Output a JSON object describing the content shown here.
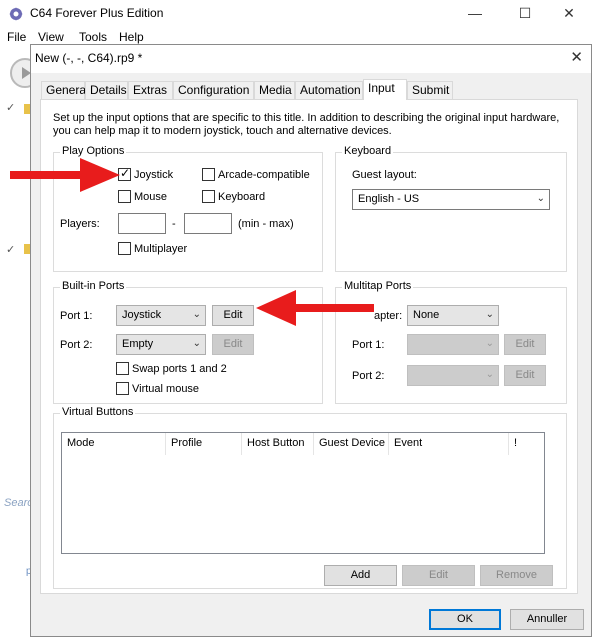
{
  "main_window": {
    "title": "C64 Forever Plus Edition",
    "menu": [
      "File",
      "View",
      "Tools",
      "Help"
    ],
    "search_placeholder": "Searc"
  },
  "dialog": {
    "title": "New (-, -, C64).rp9 *",
    "tabs": [
      "General",
      "Details",
      "Extras",
      "Configuration",
      "Media",
      "Automation",
      "Input",
      "Submit"
    ],
    "active_tab": "Input",
    "description": "Set up the input options that are specific to this title. In addition to describing the original input hardware, you can help map it to modern joystick, touch and alternative devices.",
    "play_options": {
      "legend": "Play Options",
      "joystick": "Joystick",
      "joystick_checked": true,
      "arcade": "Arcade-compatible",
      "arcade_checked": false,
      "mouse": "Mouse",
      "mouse_checked": false,
      "keyboard": "Keyboard",
      "keyboard_checked": false,
      "players_label": "Players:",
      "players_min": "",
      "players_max": "",
      "range_sep": "-",
      "range_hint": "(min - max)",
      "multiplayer": "Multiplayer",
      "multiplayer_checked": false
    },
    "keyboard_group": {
      "legend": "Keyboard",
      "guest_layout_label": "Guest layout:",
      "guest_layout_value": "English - US"
    },
    "builtin_ports": {
      "legend": "Built-in Ports",
      "port1_label": "Port 1:",
      "port1_value": "Joystick",
      "port1_edit": "Edit",
      "port2_label": "Port 2:",
      "port2_value": "Empty",
      "port2_edit": "Edit",
      "swap": "Swap ports 1 and 2",
      "swap_checked": false,
      "virtual_mouse": "Virtual mouse",
      "virtual_mouse_checked": false
    },
    "multitap_ports": {
      "legend": "Multitap Ports",
      "adapter_label": "apter:",
      "adapter_value": "None",
      "port1_label": "Port 1:",
      "port1_value": "",
      "port1_edit": "Edit",
      "port2_label": "Port 2:",
      "port2_value": "",
      "port2_edit": "Edit"
    },
    "virtual_buttons": {
      "legend": "Virtual Buttons",
      "columns": [
        "Mode",
        "Profile",
        "Host Button",
        "Guest Device",
        "Event",
        "!"
      ],
      "rows": [],
      "add": "Add",
      "edit": "Edit",
      "remove": "Remove"
    },
    "ok": "OK",
    "cancel": "Annuller"
  },
  "colors": {
    "annotation_arrow": "#e81c1c",
    "focus_border": "#0078d7"
  }
}
